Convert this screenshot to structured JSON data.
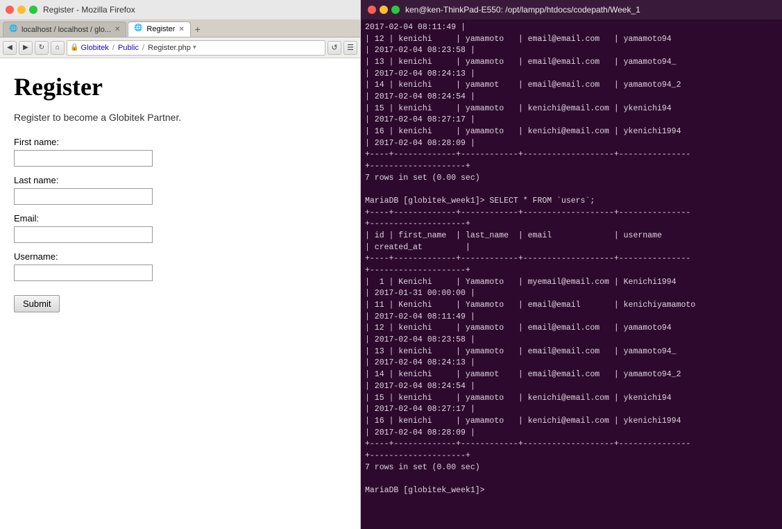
{
  "titlebar": {
    "left_title": "Register - Mozilla Firefox",
    "right_title": "ken@ken-ThinkPad-E550: /opt/lampp/htdocs/codepath/Week_1"
  },
  "browser": {
    "tab_inactive_label": "localhost / localhost / glo...",
    "tab_active_label": "Register",
    "address_breadcrumb": "Globitek   Public   Register.php",
    "page_title": "Register",
    "page_subtitle": "Register to become a Globitek Partner.",
    "first_name_label": "First name:",
    "last_name_label": "Last name:",
    "email_label": "Email:",
    "username_label": "Username:",
    "submit_label": "Submit",
    "first_name_placeholder": "",
    "last_name_placeholder": "",
    "email_placeholder": "",
    "username_placeholder": ""
  },
  "terminal": {
    "title": "ken@ken-ThinkPad-E550: /opt/lampp/htdocs/codepath/Week_1",
    "content": "2017-02-04 08:11:49 |\n| 12 | kenichi     | yamamoto   | email@email.com   | yamamoto94\n| 2017-02-04 08:23:58 |\n| 13 | kenichi     | yamamoto   | email@email.com   | yamamoto94_\n| 2017-02-04 08:24:13 |\n| 14 | kenichi     | yamamot    | email@email.com   | yamamoto94_2\n| 2017-02-04 08:24:54 |\n| 15 | kenichi     | yamamoto   | kenichi@email.com | ykenichi94\n| 2017-02-04 08:27:17 |\n| 16 | kenichi     | yamamoto   | kenichi@email.com | ykenichi1994\n| 2017-02-04 08:28:09 |\n+----+-------------+------------+-------------------+---------------\n+--------------------+\n7 rows in set (0.00 sec)\n\nMariaDB [globitek_week1]> SELECT * FROM `users`;\n+----+-------------+------------+-------------------+---------------\n+--------------------+\n| id | first_name  | last_name  | email             | username\n| created_at         |\n+----+-------------+------------+-------------------+---------------\n+--------------------+\n|  1 | Kenichi     | Yamamoto   | myemail@email.com | Kenichi1994\n| 2017-01-31 00:00:00 |\n| 11 | Kenichi     | Yamamoto   | email@email       | kenichiyamamoto\n| 2017-02-04 08:11:49 |\n| 12 | kenichi     | yamamoto   | email@email.com   | yamamoto94\n| 2017-02-04 08:23:58 |\n| 13 | kenichi     | yamamoto   | email@email.com   | yamamoto94_\n| 2017-02-04 08:24:13 |\n| 14 | kenichi     | yamamot    | email@email.com   | yamamoto94_2\n| 2017-02-04 08:24:54 |\n| 15 | kenichi     | yamamoto   | kenichi@email.com | ykenichi94\n| 2017-02-04 08:27:17 |\n| 16 | kenichi     | yamamoto   | kenichi@email.com | ykenichi1994\n| 2017-02-04 08:28:09 |\n+----+-------------+------------+-------------------+---------------\n+--------------------+\n7 rows in set (0.00 sec)\n\nMariaDB [globitek_week1]> "
  }
}
